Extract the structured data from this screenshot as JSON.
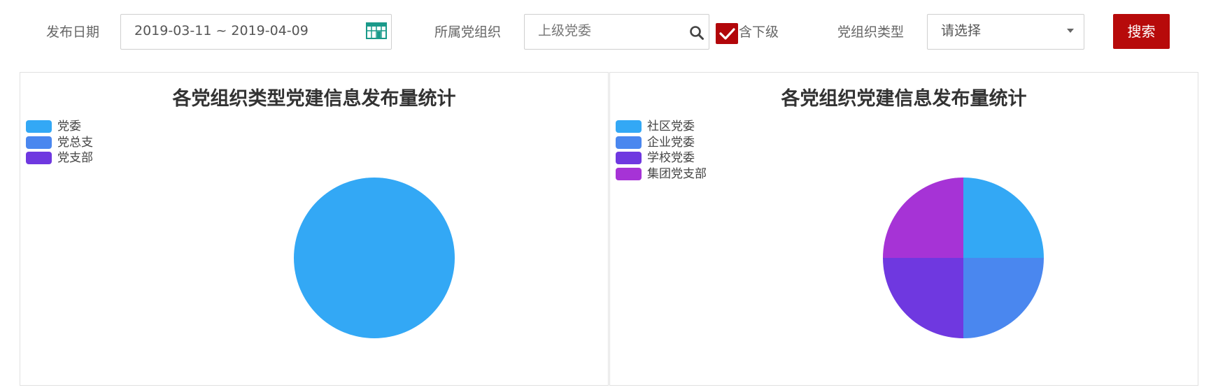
{
  "filters": {
    "date_label": "发布日期",
    "date_value": "2019-03-11 ~ 2019-04-09",
    "org_label": "所属党组织",
    "org_placeholder": "上级党委",
    "include_sub_label": "含下级",
    "include_sub_checked": true,
    "org_type_label": "党组织类型",
    "org_type_value": "请选择",
    "search_button": "搜索"
  },
  "colors": {
    "accent": "#b70a0a",
    "slice_1": "#33a8f5",
    "slice_2": "#4a87ef",
    "slice_3": "#6f38e0",
    "slice_4": "#a633d6"
  },
  "charts": {
    "left_title": "各党组织类型党建信息发布量统计",
    "right_title": "各党组织党建信息发布量统计"
  },
  "chart_data": [
    {
      "type": "pie",
      "title": "各党组织类型党建信息发布量统计",
      "categories": [
        "党委",
        "党总支",
        "党支部"
      ],
      "values": [
        1,
        0,
        0
      ],
      "colors": [
        "#33a8f5",
        "#4a87ef",
        "#6f38e0"
      ],
      "legend": "top-left"
    },
    {
      "type": "pie",
      "title": "各党组织党建信息发布量统计",
      "categories": [
        "社区党委",
        "企业党委",
        "学校党委",
        "集团党支部"
      ],
      "values": [
        1,
        1,
        1,
        1
      ],
      "colors": [
        "#33a8f5",
        "#4a87ef",
        "#6f38e0",
        "#a633d6"
      ],
      "legend": "top-left"
    }
  ]
}
